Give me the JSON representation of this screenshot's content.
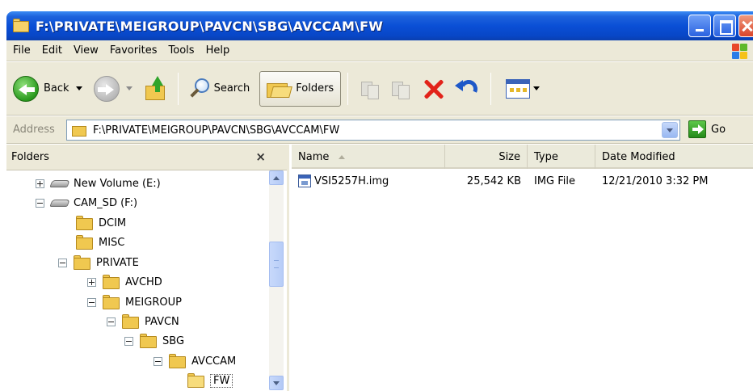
{
  "window": {
    "title": "F:\\PRIVATE\\MEIGROUP\\PAVCN\\SBG\\AVCCAM\\FW"
  },
  "menu": {
    "items": [
      "File",
      "Edit",
      "View",
      "Favorites",
      "Tools",
      "Help"
    ]
  },
  "toolbar": {
    "back_label": "Back",
    "search_label": "Search",
    "folders_label": "Folders"
  },
  "address": {
    "label": "Address",
    "value": "F:\\PRIVATE\\MEIGROUP\\PAVCN\\SBG\\AVCCAM\\FW",
    "go_label": "Go"
  },
  "folders_pane": {
    "title": "Folders",
    "close_glyph": "×",
    "tree": [
      {
        "label": "New Volume (E:)"
      },
      {
        "label": "CAM_SD (F:)"
      },
      {
        "label": "DCIM"
      },
      {
        "label": "MISC"
      },
      {
        "label": "PRIVATE"
      },
      {
        "label": "AVCHD"
      },
      {
        "label": "MEIGROUP"
      },
      {
        "label": "PAVCN"
      },
      {
        "label": "SBG"
      },
      {
        "label": "AVCCAM"
      },
      {
        "label": "FW"
      }
    ]
  },
  "file_list": {
    "columns": {
      "name": "Name",
      "size": "Size",
      "type": "Type",
      "date": "Date Modified"
    },
    "rows": [
      {
        "name": "VSI5257H.img",
        "size": "25,542 KB",
        "type": "IMG File",
        "date": "12/21/2010 3:32 PM"
      }
    ]
  },
  "colors": {
    "titlebar": "#0a4fd6",
    "chrome": "#ece9d8",
    "folder": "#f0c850"
  }
}
